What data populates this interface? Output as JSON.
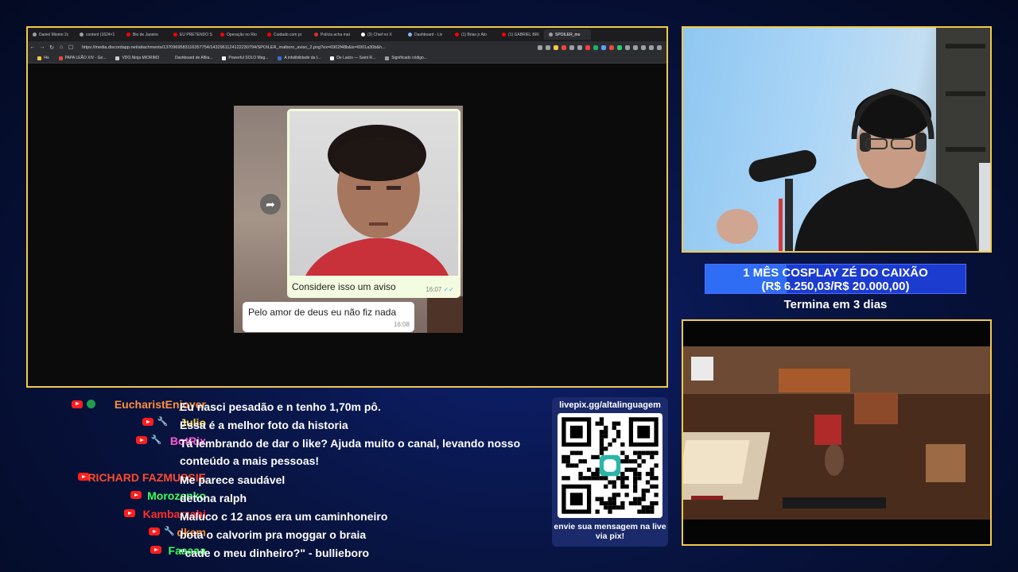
{
  "browser": {
    "tabs": [
      {
        "label": "Daniel Miorim 2c",
        "color": "#9aa0a6"
      },
      {
        "label": "content (1624×1",
        "color": "#9aa0a6"
      },
      {
        "label": "Bio de Janeiro",
        "color": "#ff0000"
      },
      {
        "label": "EU PRETENDO S",
        "color": "#ff0000"
      },
      {
        "label": "Operação no Rio",
        "color": "#ff0000"
      },
      {
        "label": "Cuidado com pr",
        "color": "#ff0000"
      },
      {
        "label": "Polícia acha mat",
        "color": "#d93025"
      },
      {
        "label": "(3) Chief no X",
        "color": "#ffffff"
      },
      {
        "label": "Dashboard - Liv",
        "color": "#8ab4f8"
      },
      {
        "label": "(1) Brian jr Ato",
        "color": "#ff0000"
      },
      {
        "label": "(1) GABRIEL BRI",
        "color": "#ff0000"
      },
      {
        "label": "SPOILER_mo",
        "color": "#9aa0a6"
      }
    ],
    "url": "https://media.discordapp.net/attachments/1370969583116357754/1432961124122230794/SPOILER_malboro_aviso_2.png?ex=6902f48b&is=6901a30b&h...",
    "bookmarks": [
      {
        "label": "I4s",
        "color": "#f2c84b"
      },
      {
        "label": "PAPA LEÃO XIV - Go...",
        "color": "#e84b3c"
      },
      {
        "label": "VDO.Ninja MIORIM3",
        "color": "#cccccc"
      },
      {
        "label": "Dashboard de Afilia...",
        "color": "#2c2d31"
      },
      {
        "label": "Powerful SOLO Mag...",
        "color": "#ffffff"
      },
      {
        "label": "A infalibilidade da I...",
        "color": "#3a6fd8"
      },
      {
        "label": "De Laicis — Saint R...",
        "color": "#ffffff"
      },
      {
        "label": "Significado código...",
        "color": "#9aa0a6"
      }
    ]
  },
  "chat_image": {
    "bubble1_text": "Considere isso um aviso",
    "bubble1_time": "16:07",
    "bubble1_checks": "✓✓",
    "bubble2_text": "Pelo amor de deus eu não fiz nada",
    "bubble2_time": "16:08"
  },
  "goal": {
    "title": "1 MÊS COSPLAY ZÉ DO CAIXÃO",
    "amount": "(R$ 6.250,03/R$ 20.000,00)",
    "progress_fraction": 0.3125,
    "ends": "Termina em 3 dias"
  },
  "chat": [
    {
      "user": "EucharistEnjoyer",
      "color": "#ff8f3f",
      "badges": [
        "yt",
        "green"
      ],
      "text": "Eu nasci pesadão e n tenho 1,70m pô."
    },
    {
      "user": "Julio",
      "color": "#ffd84a",
      "badges": [
        "yt",
        "wrench"
      ],
      "text": "Essa é a melhor foto da historia"
    },
    {
      "user": "BotRix",
      "color": "#ff59d6",
      "badges": [
        "yt",
        "wrench"
      ],
      "text": "Tá lembrando de dar o like? Ajuda muito o canal, levando nosso conteúdo a mais pessoas!"
    },
    {
      "user": "RICHARD FAZMUSSIE",
      "color": "#ff4a2b",
      "badges": [
        "yt"
      ],
      "text": "Me parece saudável"
    },
    {
      "user": "Morozenko",
      "color": "#3cff5a",
      "badges": [
        "yt"
      ],
      "text": "detona ralph"
    },
    {
      "user": "Kambarzahi",
      "color": "#ff2e2e",
      "badges": [
        "yt"
      ],
      "text": "Maluco c 12 anos era um caminhoneiro"
    },
    {
      "user": "dkem",
      "color": "#ff8a2b",
      "badges": [
        "yt",
        "wrench"
      ],
      "text": "bota o calvorim pra moggar o braia"
    },
    {
      "user": "Faaaaa",
      "color": "#3cff5a",
      "badges": [
        "yt"
      ],
      "text": "\"cade o meu dinheiro?\" - bullieboro"
    }
  ],
  "qr": {
    "url": "livepix.gg/altalinguagem",
    "footer": "envie sua mensagem na live via pix!"
  }
}
